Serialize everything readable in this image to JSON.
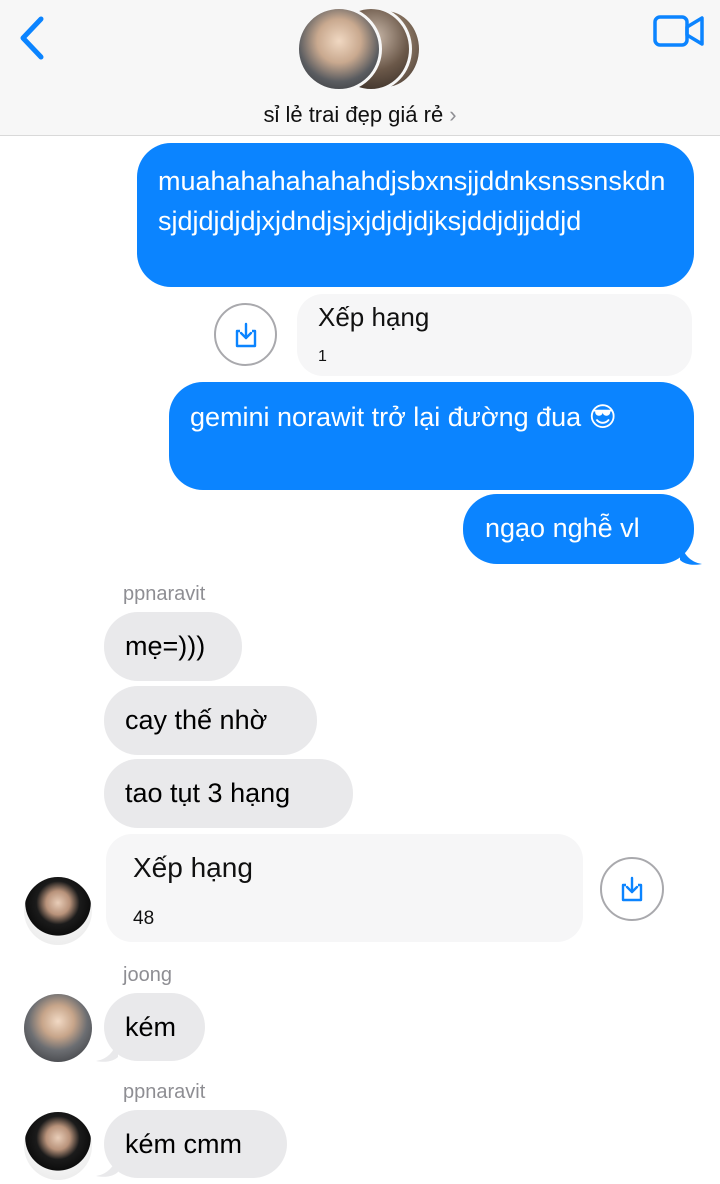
{
  "header": {
    "group_name": "sỉ lẻ trai đẹp giá rẻ",
    "chevron": "›",
    "back_icon": "chevron-left-icon",
    "video_icon": "video-camera-icon",
    "accent_color": "#0b84ff"
  },
  "messages": {
    "out1": "muahahahahahahdjsbxnsjjddnksnssnskdnsjdjdjdjdjxjdndjsjxjdjdjdjksjddjdjjddjd",
    "card1": {
      "title": "Xếp hạng",
      "value": "1"
    },
    "out2": "gemini norawit trở lại đường đua 😎",
    "out3": "ngạo nghễ vl",
    "sender1": "ppnaravit",
    "in1": "mẹ=)))",
    "in2": "cay thế nhờ",
    "in3": "tao tụt 3 hạng",
    "card2": {
      "title": "Xếp hạng",
      "value": "48"
    },
    "sender2": "joong",
    "in4": "kém",
    "sender3": "ppnaravit",
    "in5": "kém cmm"
  },
  "colors": {
    "outgoing_bubble": "#0b84ff",
    "incoming_bubble": "#e9e9eb",
    "header_bg": "#f7f7f7"
  }
}
